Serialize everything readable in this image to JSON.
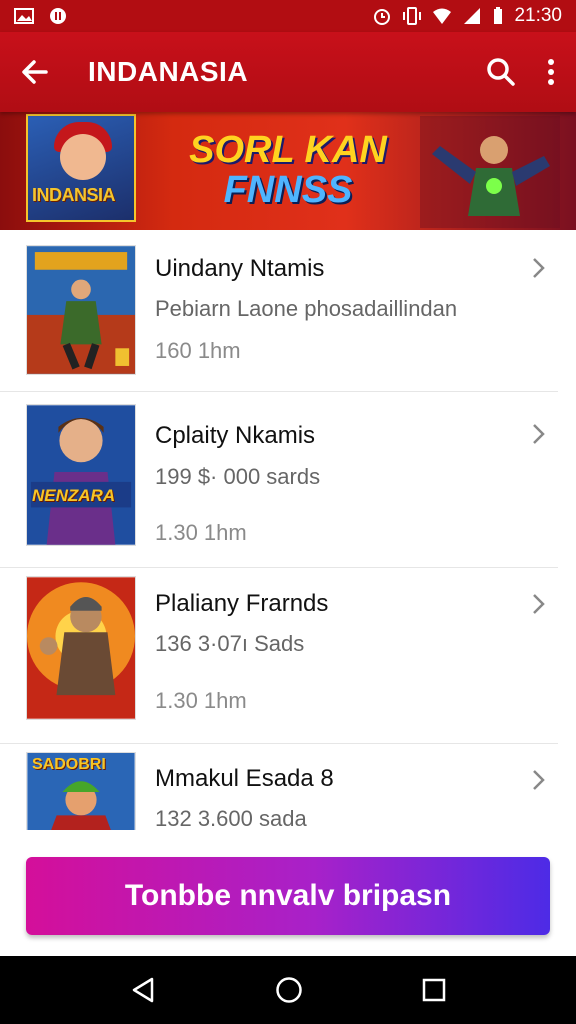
{
  "status_bar": {
    "time": "21:30"
  },
  "app_bar": {
    "title": "INDANASIA",
    "back_icon": "arrow-left-icon",
    "search_icon": "search-icon",
    "menu_icon": "more-vert-icon"
  },
  "banner": {
    "logo_text": "INDANSIA",
    "headline_line1": "SORL KAN",
    "headline_line2": "FNNSS"
  },
  "items": [
    {
      "name": "Uindany Ntamis",
      "line2": "Pebiarn Laone phosadaillindan",
      "line3": "160 1hm"
    },
    {
      "name": "Cplaity Nkamis",
      "line2": "199 $· 000 sards",
      "line3": "1.30 1hm",
      "art_label": "NENZARA"
    },
    {
      "name": "Plaliany Frarnds",
      "line2": "136 3·07ı  Sads",
      "line3": "1.30 1hm"
    },
    {
      "name": "Mmakul Esada 8",
      "line2": "132 3.600 sada",
      "line3": "",
      "art_label": "SADOBRI"
    }
  ],
  "cta": {
    "label": "Tonbbe nnvalv bripasn"
  },
  "colors": {
    "primary": "#c8101a",
    "cta_start": "#d40f9a",
    "cta_end": "#4d2be6"
  }
}
